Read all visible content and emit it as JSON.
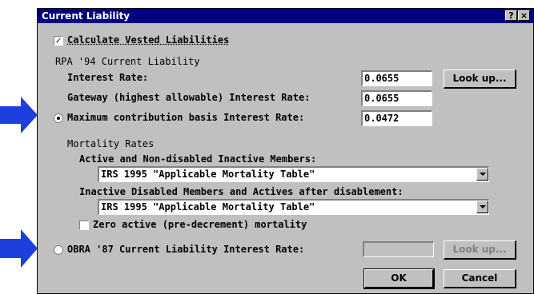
{
  "window": {
    "title": "Current Liability",
    "help_label": "?",
    "close_label": "×"
  },
  "calc_vested": {
    "label": "Calculate Vested Liabilities",
    "checked": true,
    "check_mark": "✓"
  },
  "rpa": {
    "heading": "RPA '94 Current Liability",
    "interest_rate_label": "Interest Rate:",
    "interest_rate_value": "0.0655",
    "lookup_label": "Look up...",
    "gateway_label": "Gateway (highest allowable) Interest Rate:",
    "gateway_value": "0.0655",
    "max_contrib_label": "Maximum contribution basis Interest Rate:",
    "max_contrib_value": "0.0472",
    "max_contrib_selected": true
  },
  "mortality": {
    "heading": "Mortality Rates",
    "active_label": "Active and Non-disabled Inactive Members:",
    "active_value": "IRS 1995 \"Applicable Mortality Table\"",
    "disabled_label": "Inactive Disabled Members and Actives after disablement:",
    "disabled_value": "IRS 1995 \"Applicable Mortality Table\"",
    "zero_active_label": "Zero active (pre-decrement) mortality",
    "zero_active_checked": false
  },
  "obra": {
    "label": "OBRA '87 Current Liability Interest Rate:",
    "value": "",
    "selected": false,
    "lookup_label": "Look up..."
  },
  "buttons": {
    "ok": "OK",
    "cancel": "Cancel"
  },
  "colors": {
    "titlebar": "#000080",
    "dialog_face": "#c0c0c0",
    "arrow": "#1f3ee0"
  }
}
